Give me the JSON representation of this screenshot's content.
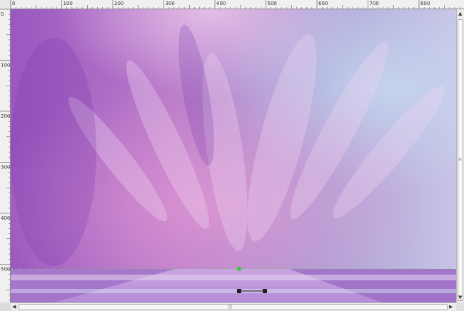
{
  "horizontal_ruler": {
    "ticks": [
      "0",
      "100",
      "200",
      "300",
      "400",
      "500",
      "600",
      "700",
      "800"
    ]
  },
  "vertical_ruler": {
    "ticks": [
      "0",
      "100",
      "200",
      "300",
      "400",
      "500"
    ]
  },
  "canvas": {
    "image_description_icon": "purple-sky-with-checkered-floor-image"
  },
  "scroll_arrows": {
    "up": "▲",
    "down": "▼",
    "left": "◀",
    "right": "▶",
    "grip_v": "≡",
    "grip_h": "|||"
  }
}
